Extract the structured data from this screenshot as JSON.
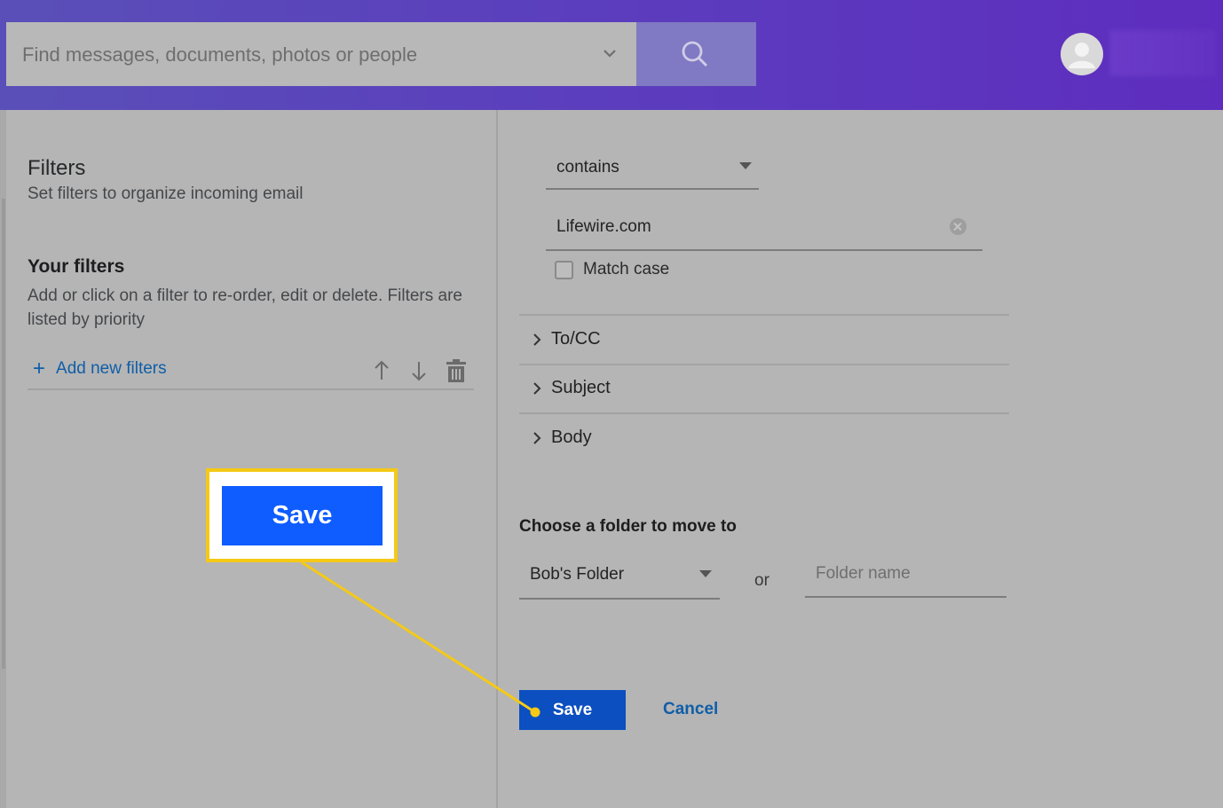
{
  "header": {
    "search_placeholder": "Find messages, documents, photos or people",
    "icons": [
      "chevron-down-icon",
      "search-icon",
      "user-avatar-icon"
    ]
  },
  "left": {
    "title": "Filters",
    "subtitle": "Set filters to organize incoming email",
    "your_filters_title": "Your filters",
    "your_filters_desc": "Add or click on a filter to re-order, edit or delete. Filters are listed by priority",
    "add_new_filters": "Add new filters",
    "tool_icons": [
      "arrow-up-icon",
      "arrow-down-icon",
      "trash-icon"
    ]
  },
  "callout": {
    "save_label": "Save",
    "frame_color": "#f5c916"
  },
  "right": {
    "condition_select": "contains",
    "condition_value": "Lifewire.com",
    "match_case_label": "Match case",
    "match_case_checked": false,
    "sections": [
      "To/CC",
      "Subject",
      "Body"
    ],
    "folder_title": "Choose a folder to move to",
    "folder_select": "Bob's Folder",
    "or_label": "or",
    "folder_name_placeholder": "Folder name",
    "save_label": "Save",
    "cancel_label": "Cancel"
  },
  "colors": {
    "header_gradient_start": "#5a4fb8",
    "header_gradient_end": "#5e2dbf",
    "primary_button": "#0b4fc0",
    "callout_button": "#0f5cff",
    "link": "#0f5ea8",
    "highlight": "#f5c916"
  }
}
